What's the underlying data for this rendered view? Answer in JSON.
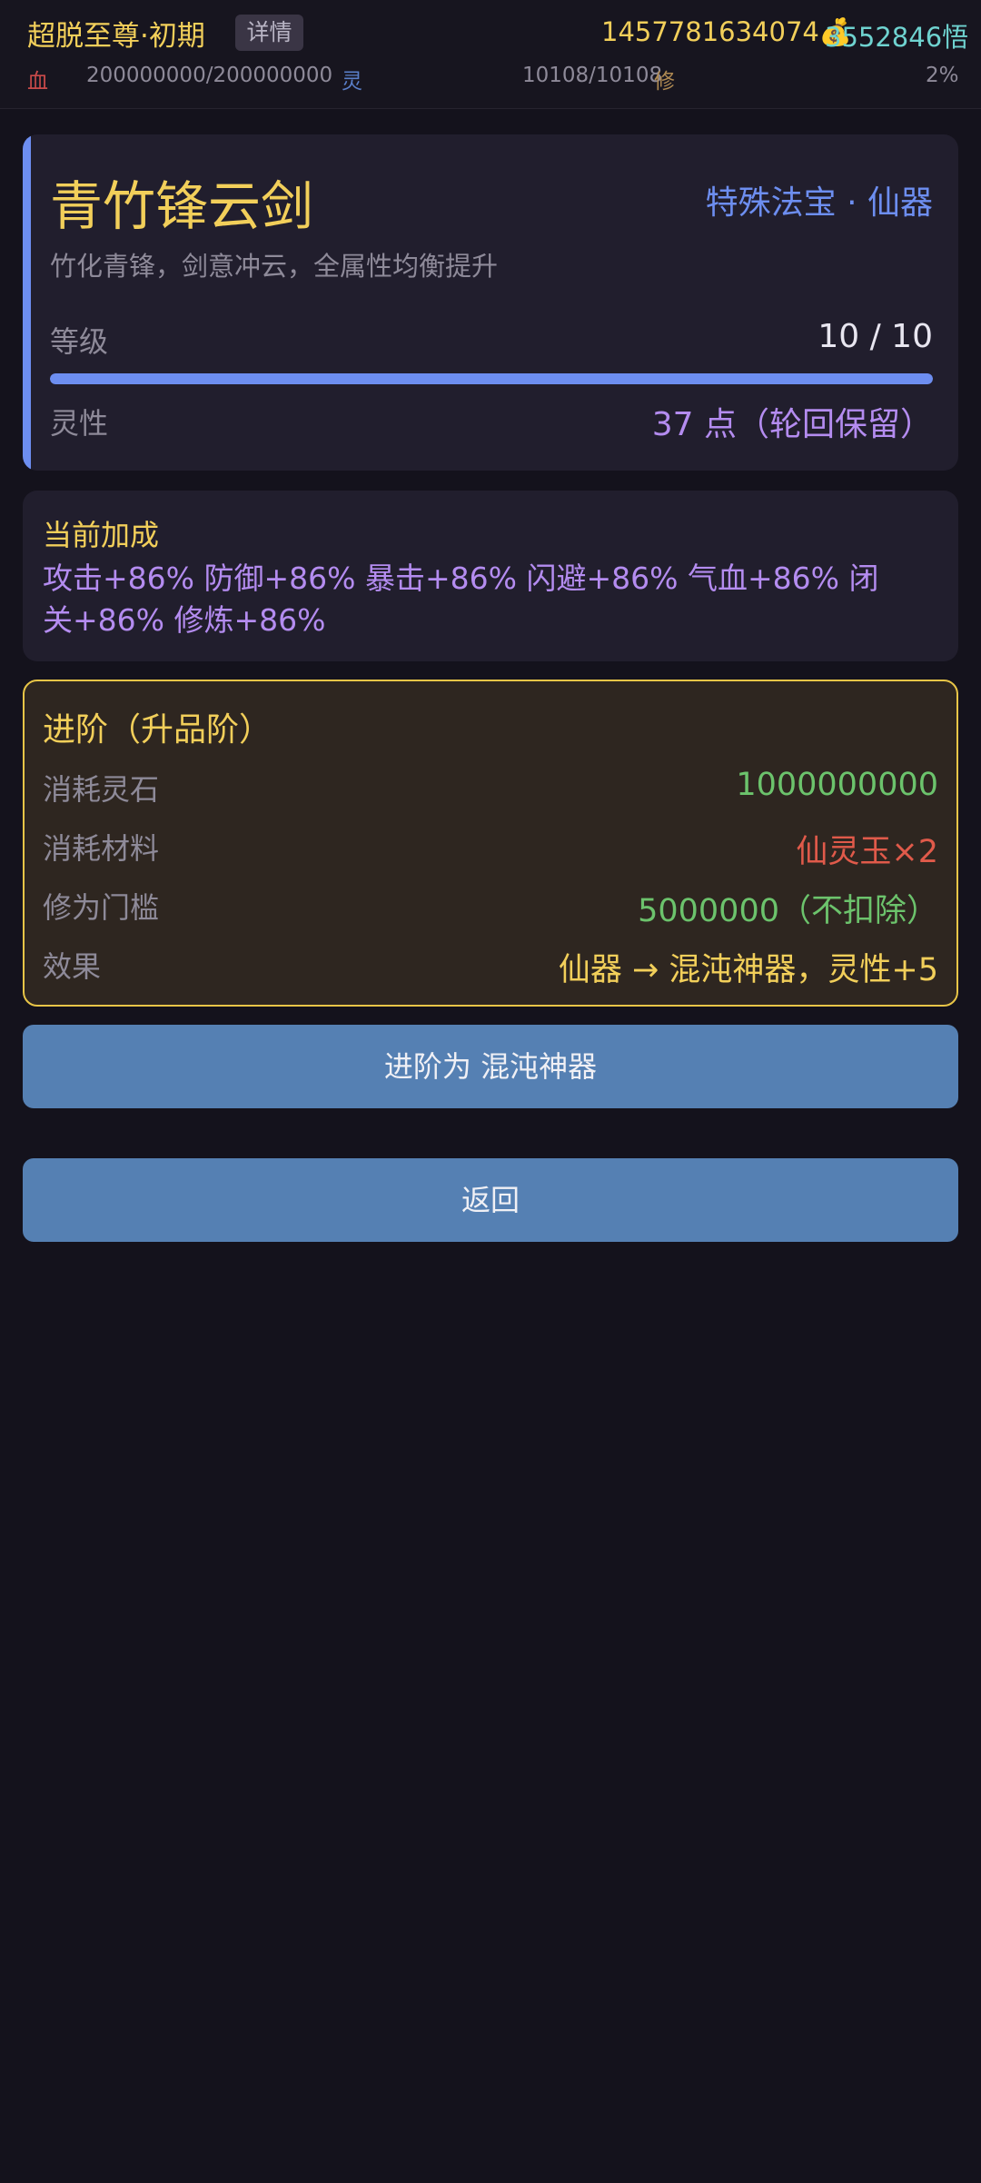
{
  "header": {
    "realm": "超脱至尊·初期",
    "detail_label": "详情",
    "gold": "1457781634074💰",
    "wu": "3552846悟",
    "hp_label": "血",
    "hp_value": "200000000/200000000",
    "ling_label": "灵",
    "ling_value": "10108/10108",
    "xiu_label": "修",
    "xiu_value": "2%"
  },
  "item": {
    "name": "青竹锋云剑",
    "type": "特殊法宝 · 仙器",
    "description": "竹化青锋，剑意冲云，全属性均衡提升",
    "level_label": "等级",
    "level_value": "10 / 10",
    "level_fraction": 1.0,
    "spirit_label": "灵性",
    "spirit_value": "37 点（轮回保留）"
  },
  "bonus": {
    "title": "当前加成",
    "text": "攻击+86%  防御+86%  暴击+86%  闪避+86%  气血+86%  闭关+86%  修炼+86%"
  },
  "advance": {
    "title": "进阶（升品阶）",
    "rows": [
      {
        "label": "消耗灵石",
        "value": "1000000000"
      },
      {
        "label": "消耗材料",
        "value": "仙灵玉×2"
      },
      {
        "label": "修为门槛",
        "value": "5000000（不扣除）"
      },
      {
        "label": "效果",
        "value": "仙器 → 混沌神器，灵性+5"
      }
    ]
  },
  "buttons": {
    "advance_label": "进阶为 混沌神器",
    "back_label": "返回"
  },
  "colors": {
    "gold": "#f2cf5a",
    "accent_blue": "#6d8ef0",
    "purple": "#b48cf0",
    "green": "#6cc36c",
    "red": "#e05a4a",
    "button": "#5580b3"
  }
}
